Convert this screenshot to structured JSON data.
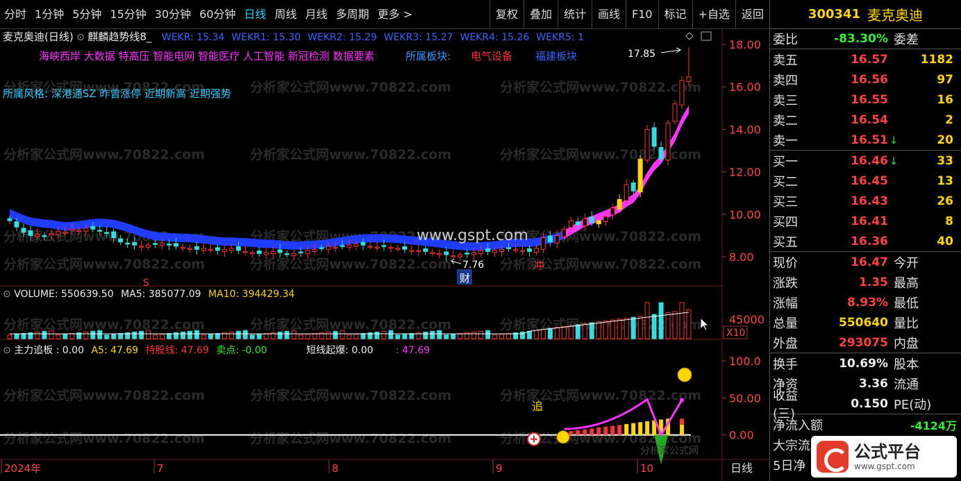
{
  "toolbar": {
    "timeframes": [
      "分时",
      "1分钟",
      "5分钟",
      "15分钟",
      "30分钟",
      "60分钟",
      "日线",
      "周线",
      "月线",
      "多周期",
      "更多 >"
    ],
    "active_index": 6,
    "tools": [
      "复权",
      "叠加",
      "统计",
      "画线",
      "F10",
      "标记",
      "+自选",
      "返回"
    ]
  },
  "main": {
    "stock_title": "麦克奥迪(日线)",
    "indicator_name": "麒麟趋势线8_",
    "wekr": [
      "WEKR: 15.34",
      "WEKR1: 15.30",
      "WEKR2: 15.29",
      "WEKR3: 15.27",
      "WEKR4: 15.26",
      "WEKR5: 1"
    ],
    "concepts": "海峡西岸 大数据 特高压 智能电网 智能医疗 人工智能 新冠检测 数据要素",
    "sector_label": "所属板块:",
    "sector_value": "电气设备",
    "sector_extra": "福建板块",
    "style_line": "所属风格: 深港通SZ 昨曾涨停 近期新高 近期强势",
    "high_label": "17.85",
    "low_label": "7.76",
    "cai_label": "财",
    "chong_label": "冲",
    "s_label": "S",
    "watermark_site": "www.gspt.com",
    "watermark_repeat": "分析家公式网www.70822.com",
    "watermark_small": "分析家公式网",
    "price_ticks": [
      "18.00",
      "16.00",
      "14.00",
      "12.00",
      "10.00",
      "8.00"
    ]
  },
  "volume": {
    "label": "VOLUME: 550639.50",
    "ma5": "MA5: 385077.09",
    "ma10": "MA10: 394429.34",
    "tick": "45000",
    "unit": "X10"
  },
  "indicator": {
    "name": "主力追板 : 0.00",
    "a5": "A5: 47.69",
    "hold": "持股线: 47.69",
    "sell": "卖点: -0.00",
    "short": "短线起爆: 0.00",
    "extra": ": 47.69",
    "ticks": [
      "100.0",
      "50.00",
      "0.00"
    ],
    "zhui": "追"
  },
  "dates": {
    "labels": [
      "2024年",
      "7",
      "8",
      "9",
      "10"
    ],
    "period": "日线"
  },
  "colors": {
    "up": "#ff3333",
    "down": "#33dddd",
    "ribbon": "#1f3cff",
    "magenta": "#ff33ff",
    "yellow": "#ffd700"
  },
  "chart_data": {
    "type": "candlestick",
    "period": "日线",
    "price_ticks": [
      8,
      10,
      12,
      14,
      16,
      18
    ],
    "high": 17.85,
    "low": 7.76,
    "close": [
      9.7,
      9.4,
      9.15,
      9.0,
      9.05,
      8.95,
      9.1,
      9.2,
      9.15,
      9.3,
      9.25,
      9.35,
      9.3,
      9.2,
      9.1,
      8.9,
      8.7,
      8.6,
      8.55,
      8.5,
      8.55,
      8.6,
      8.65,
      8.55,
      8.5,
      8.45,
      8.4,
      8.35,
      8.4,
      8.35,
      8.3,
      8.35,
      8.4,
      8.3,
      8.25,
      8.2,
      8.15,
      8.2,
      8.25,
      8.2,
      8.1,
      8.15,
      8.2,
      8.3,
      8.35,
      8.4,
      8.5,
      8.45,
      8.5,
      8.55,
      8.6,
      8.55,
      8.5,
      8.45,
      8.5,
      8.45,
      8.4,
      8.35,
      8.3,
      8.3,
      8.25,
      8.2,
      8.15,
      8.1,
      8.05,
      8.1,
      8.15,
      8.2,
      8.3,
      8.25,
      8.3,
      8.35,
      8.4,
      8.35,
      8.3,
      8.25,
      8.4,
      8.9,
      8.7,
      9.0,
      9.3,
      9.7,
      9.5,
      9.8,
      9.6,
      9.7,
      9.9,
      10.3,
      10.7,
      11.4,
      11.1,
      12.6,
      14.0,
      13.2,
      12.6,
      14.3,
      15.2,
      16.3,
      16.47
    ]
  },
  "right_panel": {
    "code": "300341",
    "name": "麦克奥迪",
    "weibi": {
      "label": "委比",
      "value": "-83.30%",
      "label2": "委差"
    },
    "sells": [
      {
        "label": "卖五",
        "price": "16.57",
        "vol": "1182"
      },
      {
        "label": "卖四",
        "price": "16.56",
        "vol": "97"
      },
      {
        "label": "卖三",
        "price": "16.55",
        "vol": "16"
      },
      {
        "label": "卖二",
        "price": "16.54",
        "vol": "2"
      },
      {
        "label": "卖一",
        "price": "16.51",
        "vol": "20",
        "arrow": "↓"
      }
    ],
    "buys": [
      {
        "label": "买一",
        "price": "16.46",
        "vol": "33",
        "arrow": "↓"
      },
      {
        "label": "买二",
        "price": "16.45",
        "vol": "13"
      },
      {
        "label": "买三",
        "price": "16.43",
        "vol": "26"
      },
      {
        "label": "买四",
        "price": "16.41",
        "vol": "8"
      },
      {
        "label": "买五",
        "price": "16.36",
        "vol": "40"
      }
    ],
    "quote": [
      {
        "label": "现价",
        "value": "16.47",
        "label2": "今开"
      },
      {
        "label": "涨跌",
        "value": "1.35",
        "label2": "最高"
      },
      {
        "label": "涨幅",
        "value": "8.93%",
        "label2": "最低"
      },
      {
        "label": "总量",
        "value": "550640",
        "label2": "量比",
        "color": "#ffd700"
      },
      {
        "label": "外盘",
        "value": "293075",
        "label2": "内盘"
      }
    ],
    "fund": [
      {
        "label": "换手",
        "value": "10.69%",
        "label2": "股本"
      },
      {
        "label": "净资",
        "value": "3.36",
        "label2": "流通"
      },
      {
        "label": "收益(三)",
        "value": "0.150",
        "label2": "PE(动)"
      }
    ],
    "flow": [
      {
        "label": "净流入额",
        "value": "-4124万"
      },
      {
        "label": "大宗流",
        "value": ""
      },
      {
        "label": "5日净",
        "value": ""
      }
    ],
    "logo_text": "公式平台",
    "logo_url": "www.gspt.com"
  }
}
